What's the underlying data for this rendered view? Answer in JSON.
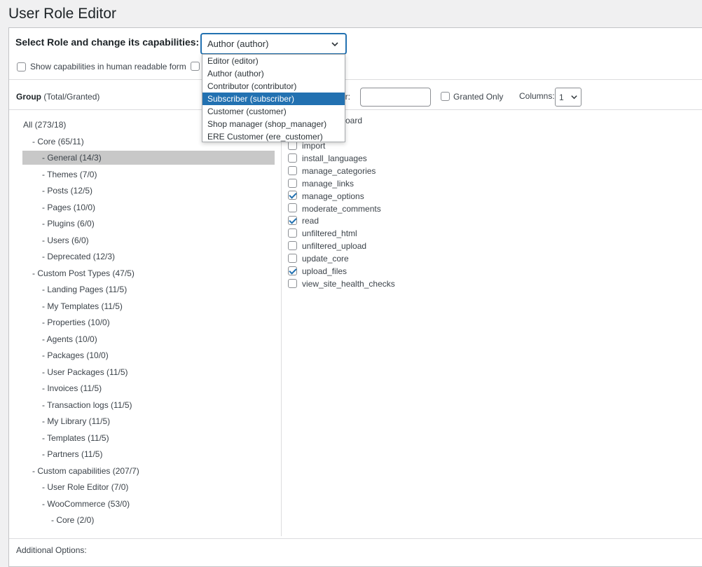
{
  "page_title": "User Role Editor",
  "role_select": {
    "label": "Select Role and change its capabilities:",
    "selected": "Author (author)",
    "options": [
      "Editor (editor)",
      "Author (author)",
      "Contributor (contributor)",
      "Subscriber (subscriber)",
      "Customer (customer)",
      "Shop manager (shop_manager)",
      "ERE Customer (ere_customer)"
    ],
    "highlighted_index": 3
  },
  "options_row": {
    "human_readable_label": "Show capabilities in human readable form"
  },
  "toolbar": {
    "group_label": "Group",
    "group_suffix": "(Total/Granted)",
    "quick_filter_partial": "er:",
    "granted_only_label": "Granted Only",
    "columns_label": "Columns:",
    "columns_value": "1"
  },
  "tree": [
    {
      "label": "All (273/18)",
      "depth": 0
    },
    {
      "label": "- Core (65/11)",
      "depth": 1
    },
    {
      "label": "- General (14/3)",
      "depth": 2,
      "selected": true
    },
    {
      "label": "- Themes (7/0)",
      "depth": 2
    },
    {
      "label": "- Posts (12/5)",
      "depth": 2
    },
    {
      "label": "- Pages (10/0)",
      "depth": 2
    },
    {
      "label": "- Plugins (6/0)",
      "depth": 2
    },
    {
      "label": "- Users (6/0)",
      "depth": 2
    },
    {
      "label": "- Deprecated (12/3)",
      "depth": 2
    },
    {
      "label": "- Custom Post Types (47/5)",
      "depth": 1
    },
    {
      "label": "- Landing Pages (11/5)",
      "depth": 2
    },
    {
      "label": "- My Templates (11/5)",
      "depth": 2
    },
    {
      "label": "- Properties (10/0)",
      "depth": 2
    },
    {
      "label": "- Agents (10/0)",
      "depth": 2
    },
    {
      "label": "- Packages (10/0)",
      "depth": 2
    },
    {
      "label": "- User Packages (11/5)",
      "depth": 2
    },
    {
      "label": "- Invoices (11/5)",
      "depth": 2
    },
    {
      "label": "- Transaction logs (11/5)",
      "depth": 2
    },
    {
      "label": "- My Library (11/5)",
      "depth": 2
    },
    {
      "label": "- Templates (11/5)",
      "depth": 2
    },
    {
      "label": "- Partners (11/5)",
      "depth": 2
    },
    {
      "label": "- Custom capabilities (207/7)",
      "depth": 1
    },
    {
      "label": "- User Role Editor (7/0)",
      "depth": 2
    },
    {
      "label": "- WooCommerce (53/0)",
      "depth": 2
    },
    {
      "label": "- Core (2/0)",
      "depth": 3
    }
  ],
  "capabilities_partial_text": "oard",
  "capabilities": [
    {
      "name": "import",
      "checked": false
    },
    {
      "name": "install_languages",
      "checked": false
    },
    {
      "name": "manage_categories",
      "checked": false
    },
    {
      "name": "manage_links",
      "checked": false
    },
    {
      "name": "manage_options",
      "checked": true
    },
    {
      "name": "moderate_comments",
      "checked": false
    },
    {
      "name": "read",
      "checked": true
    },
    {
      "name": "unfiltered_html",
      "checked": false
    },
    {
      "name": "unfiltered_upload",
      "checked": false
    },
    {
      "name": "update_core",
      "checked": false
    },
    {
      "name": "upload_files",
      "checked": true
    },
    {
      "name": "view_site_health_checks",
      "checked": false
    }
  ],
  "additional_options_label": "Additional Options:",
  "colors": {
    "accent": "#2271b1",
    "selected_row_bg": "#c8c8c8",
    "page_bg": "#f0f0f1"
  }
}
